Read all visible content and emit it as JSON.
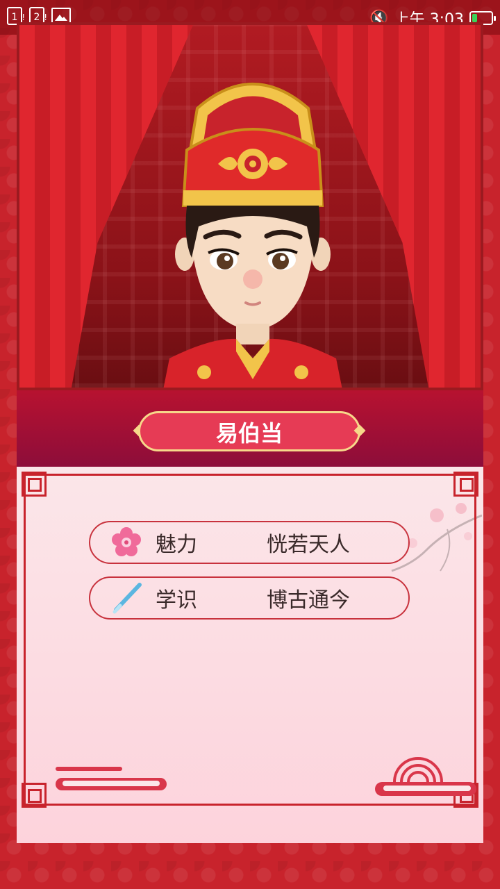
{
  "status_bar": {
    "sim1": "1",
    "sim2": "2",
    "mute": "🔇",
    "time": "上午 3:03",
    "battery_level": 0.25
  },
  "icons": {
    "sim1": "sim-card-1-icon",
    "sim2": "sim-card-2-icon",
    "image": "image-notification-icon",
    "mute": "mute-icon",
    "battery": "battery-icon",
    "plum": "plum-blossom-icon",
    "brush": "brush-icon"
  },
  "character": {
    "name": "易伯当"
  },
  "attributes": [
    {
      "label": "魅力",
      "value": "恍若天人",
      "icon": "plum-blossom-icon"
    },
    {
      "label": "学识",
      "value": "博古通今",
      "icon": "brush-icon"
    }
  ],
  "colors": {
    "background": "#c8232c",
    "name_plate": "#e63b55",
    "gold": "#f7d88a",
    "panel": "#fbe6e9"
  }
}
